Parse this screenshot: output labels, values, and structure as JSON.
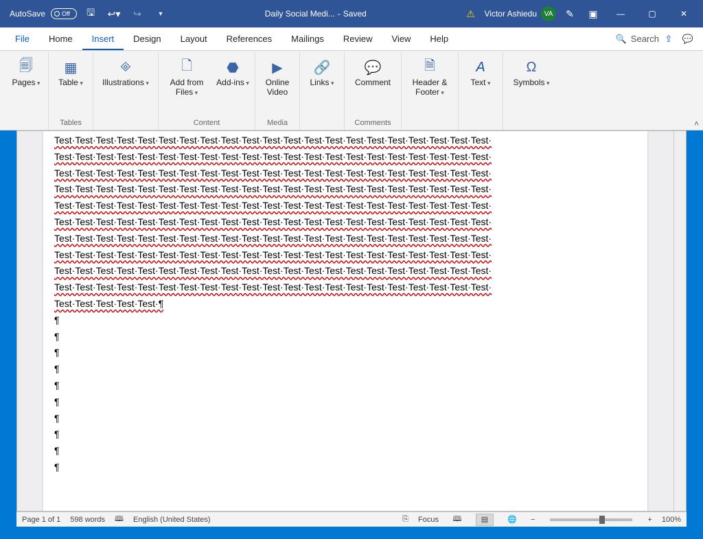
{
  "titlebar": {
    "autosave_label": "AutoSave",
    "autosave_state": "Off",
    "doc_title": "Daily Social Medi...",
    "doc_status": "Saved",
    "alert_icon": "warning-triangle",
    "user_name": "Victor Ashiedu",
    "user_initials": "VA"
  },
  "tabs": {
    "file": "File",
    "home": "Home",
    "insert": "Insert",
    "design": "Design",
    "layout": "Layout",
    "references": "References",
    "mailings": "Mailings",
    "review": "Review",
    "view": "View",
    "help": "Help",
    "search": "Search",
    "active": "insert"
  },
  "ribbon": {
    "pages": {
      "btn": "Pages"
    },
    "tables": {
      "btn": "Table",
      "group": "Tables"
    },
    "illustrations": {
      "btn": "Illustrations"
    },
    "content": {
      "addfrom": "Add from Files",
      "addins": "Add-ins",
      "group": "Content"
    },
    "media": {
      "btn": "Online Video",
      "group": "Media"
    },
    "links": {
      "btn": "Links"
    },
    "comments": {
      "btn": "Comment",
      "group": "Comments"
    },
    "headerfooter": {
      "btn": "Header & Footer"
    },
    "text": {
      "btn": "Text"
    },
    "symbols": {
      "btn": "Symbols"
    }
  },
  "document": {
    "test_word": "Test",
    "sep": "·",
    "pilcrow": "¶",
    "full_line_repeats": 21,
    "full_lines": 10,
    "partial_line_repeats": 5,
    "empty_paragraphs": 10
  },
  "statusbar": {
    "page": "Page 1 of 1",
    "words": "598 words",
    "lang": "English (United States)",
    "focus": "Focus",
    "zoom_minus": "−",
    "zoom_plus": "+",
    "zoom_value": "100%"
  },
  "colors": {
    "title_bg": "#2f5597",
    "accent": "#0a5ac2",
    "desktop": "#0078d4"
  }
}
